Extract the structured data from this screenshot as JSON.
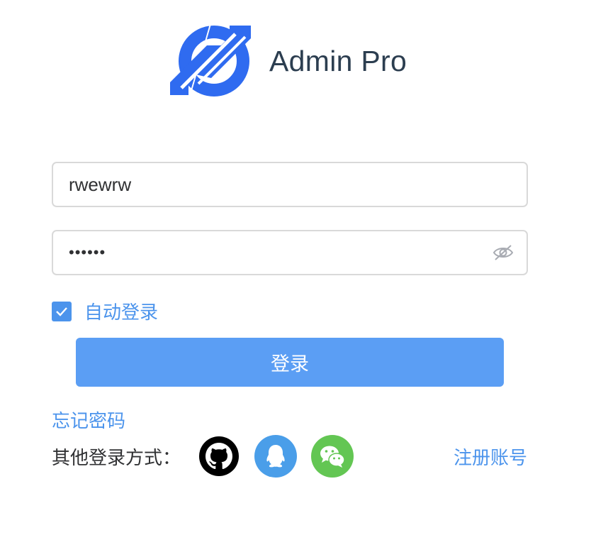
{
  "brand": {
    "title": "Admin Pro",
    "logo_icon": "admin-pro-logo-icon",
    "color": "#2f6bf0"
  },
  "form": {
    "username_value": "rwewrw",
    "password_value": "••••••",
    "password_toggle_icon": "eye-slash-icon",
    "remember_label": "自动登录",
    "remember_checked": true,
    "login_label": "登录",
    "forgot_label": "忘记密码",
    "other_login_label": "其他登录方式：",
    "register_label": "注册账号"
  },
  "social": [
    {
      "name": "github-icon",
      "color": "#000000"
    },
    {
      "name": "qq-icon",
      "color": "#4a9ee9"
    },
    {
      "name": "wechat-icon",
      "color": "#63c653"
    }
  ],
  "colors": {
    "accent": "#4c94ec",
    "button": "#5b9ef4",
    "text": "#303133",
    "border": "#d9d9d9"
  }
}
